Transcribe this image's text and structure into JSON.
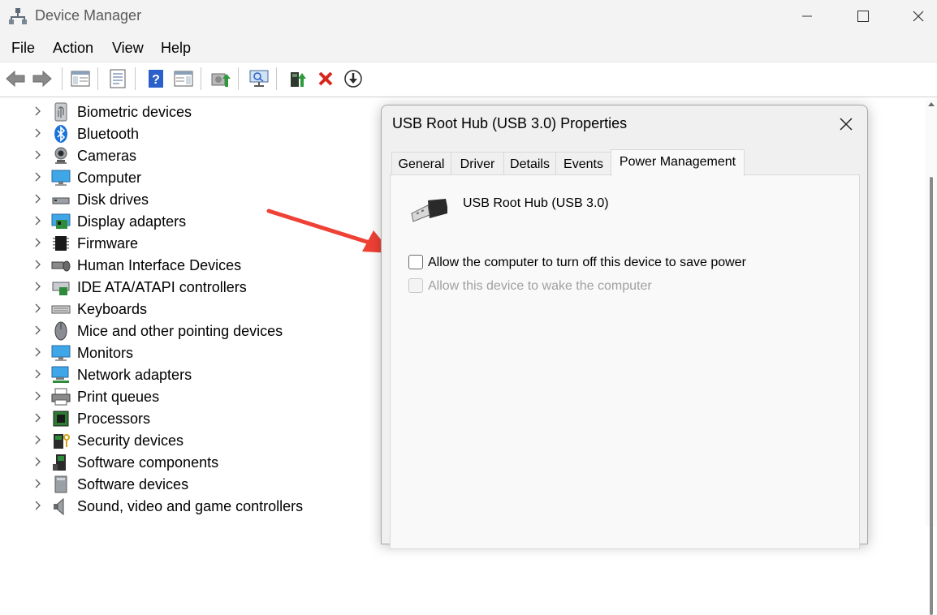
{
  "window": {
    "title": "Device Manager"
  },
  "menu": {
    "items": [
      "File",
      "Action",
      "View",
      "Help"
    ]
  },
  "tree": {
    "items": [
      {
        "label": "Biometric devices",
        "icon": "fingerprint-icon"
      },
      {
        "label": "Bluetooth",
        "icon": "bluetooth-icon"
      },
      {
        "label": "Cameras",
        "icon": "camera-icon"
      },
      {
        "label": "Computer",
        "icon": "monitor-icon"
      },
      {
        "label": "Disk drives",
        "icon": "disk-drive-icon"
      },
      {
        "label": "Display adapters",
        "icon": "display-adapter-icon"
      },
      {
        "label": "Firmware",
        "icon": "firmware-chip-icon"
      },
      {
        "label": "Human Interface Devices",
        "icon": "hid-icon"
      },
      {
        "label": "IDE ATA/ATAPI controllers",
        "icon": "ide-controller-icon"
      },
      {
        "label": "Keyboards",
        "icon": "keyboard-icon"
      },
      {
        "label": "Mice and other pointing devices",
        "icon": "mouse-icon"
      },
      {
        "label": "Monitors",
        "icon": "monitor-icon"
      },
      {
        "label": "Network adapters",
        "icon": "network-adapter-icon"
      },
      {
        "label": "Print queues",
        "icon": "printer-icon"
      },
      {
        "label": "Processors",
        "icon": "processor-icon"
      },
      {
        "label": "Security devices",
        "icon": "security-device-icon"
      },
      {
        "label": "Software components",
        "icon": "software-component-icon"
      },
      {
        "label": "Software devices",
        "icon": "software-device-icon"
      },
      {
        "label": "Sound, video and game controllers",
        "icon": "speaker-icon"
      }
    ]
  },
  "dialog": {
    "title": "USB Root Hub (USB 3.0) Properties",
    "tabs": [
      "General",
      "Driver",
      "Details",
      "Events",
      "Power Management"
    ],
    "active_tab": "Power Management",
    "device_name": "USB Root Hub (USB 3.0)",
    "options": [
      {
        "label": "Allow the computer to turn off this device to save power",
        "checked": false,
        "enabled": true
      },
      {
        "label": "Allow this device to wake the computer",
        "checked": false,
        "enabled": false
      }
    ]
  },
  "colors": {
    "annotation_arrow": "#ef4135",
    "accent": "#0078d4"
  }
}
